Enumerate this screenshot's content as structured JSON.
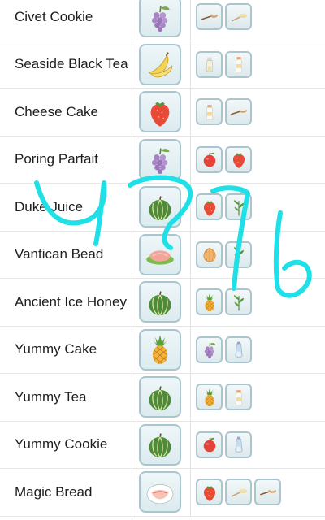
{
  "rows": [
    {
      "name": "Civet Cookie",
      "main_icon": "grapes-icon",
      "ingredients": [
        "flour-spoon-icon",
        "sugar-spoon-icon"
      ]
    },
    {
      "name": "Seaside Black Tea",
      "main_icon": "banana-icon",
      "ingredients": [
        "bottle-icon",
        "milk-bottle-icon"
      ]
    },
    {
      "name": "Cheese Cake",
      "main_icon": "strawberry-icon",
      "ingredients": [
        "milk-bottle-icon",
        "flour-spoon-icon"
      ]
    },
    {
      "name": "Poring Parfait",
      "main_icon": "grapes-icon",
      "ingredients": [
        "apple-icon",
        "strawberry-icon"
      ]
    },
    {
      "name": "Duke Juice",
      "main_icon": "melon-icon",
      "ingredients": [
        "strawberry-icon",
        "herb-icon"
      ]
    },
    {
      "name": "Vantican Bead",
      "main_icon": "salmon-platter-icon",
      "ingredients": [
        "onion-icon",
        "herb-icon"
      ]
    },
    {
      "name": "Ancient Ice Honey",
      "main_icon": "melon-icon",
      "ingredients": [
        "pineapple-icon",
        "herb-icon"
      ]
    },
    {
      "name": "Yummy Cake",
      "main_icon": "pineapple-icon",
      "ingredients": [
        "grapes-icon",
        "salt-bottle-icon"
      ]
    },
    {
      "name": "Yummy Tea",
      "main_icon": "melon-icon",
      "ingredients": [
        "pineapple-icon",
        "milk-bottle-icon"
      ]
    },
    {
      "name": "Yummy Cookie",
      "main_icon": "melon-icon",
      "ingredients": [
        "apple-icon",
        "salt-bottle-icon"
      ]
    },
    {
      "name": "Magic Bread",
      "main_icon": "bacon-icon",
      "ingredients": [
        "strawberry-icon",
        "sugar-spoon-icon",
        "flour-spoon-icon"
      ]
    }
  ],
  "colors": {
    "scribble": "#1fe0e6",
    "frame": "#a9c6cf"
  }
}
